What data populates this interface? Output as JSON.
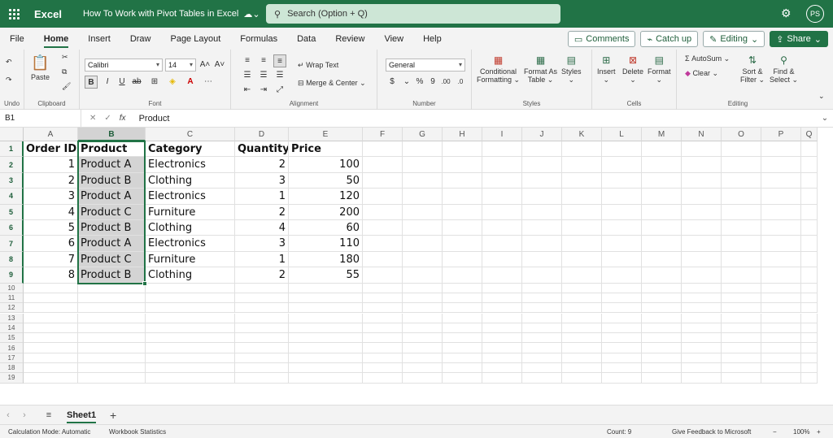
{
  "titlebar": {
    "app_name": "Excel",
    "doc_title": "How To Work with Pivot Tables in Excel",
    "search_placeholder": "Search (Option + Q)",
    "avatar_initials": "PS",
    "accent": "#217346"
  },
  "menu": {
    "tabs": [
      "File",
      "Home",
      "Insert",
      "Draw",
      "Page Layout",
      "Formulas",
      "Data",
      "Review",
      "View",
      "Help"
    ],
    "active_tab": "Home",
    "comments_label": "Comments",
    "catchup_label": "Catch up",
    "editing_label": "Editing",
    "share_label": "Share"
  },
  "ribbon": {
    "undo_label": "Undo",
    "clipboard": {
      "paste_label": "Paste",
      "group_label": "Clipboard"
    },
    "font": {
      "name": "Calibri",
      "size": "14",
      "group_label": "Font"
    },
    "alignment": {
      "wrap_label": "Wrap Text",
      "merge_label": "Merge & Center",
      "group_label": "Alignment"
    },
    "number": {
      "format": "General",
      "group_label": "Number"
    },
    "styles": {
      "conditional_label1": "Conditional",
      "conditional_label2": "Formatting",
      "format_as_label1": "Format As",
      "format_as_label2": "Table",
      "styles_label": "Styles",
      "group_label": "Styles"
    },
    "cells": {
      "insert_label": "Insert",
      "delete_label": "Delete",
      "format_label": "Format",
      "group_label": "Cells"
    },
    "editing": {
      "autosum_label": "AutoSum",
      "clear_label": "Clear",
      "sort_label1": "Sort &",
      "sort_label2": "Filter",
      "find_label1": "Find &",
      "find_label2": "Select",
      "group_label": "Editing"
    }
  },
  "formula_bar": {
    "name_box": "B1",
    "formula": "Product"
  },
  "grid": {
    "columns": [
      "A",
      "B",
      "C",
      "D",
      "E",
      "F",
      "G",
      "H",
      "I",
      "J",
      "K",
      "L",
      "M",
      "N",
      "O",
      "P",
      "Q"
    ],
    "selected_column": "B",
    "rows": [
      [
        "Order ID",
        "Product",
        "Category",
        "Quantity",
        "Price"
      ],
      [
        "1",
        "Product A",
        "Electronics",
        "2",
        "100"
      ],
      [
        "2",
        "Product B",
        "Clothing",
        "3",
        "50"
      ],
      [
        "3",
        "Product A",
        "Electronics",
        "1",
        "120"
      ],
      [
        "4",
        "Product C",
        "Furniture",
        "2",
        "200"
      ],
      [
        "5",
        "Product B",
        "Clothing",
        "4",
        "60"
      ],
      [
        "6",
        "Product A",
        "Electronics",
        "3",
        "110"
      ],
      [
        "7",
        "Product C",
        "Furniture",
        "1",
        "180"
      ],
      [
        "8",
        "Product B",
        "Clothing",
        "2",
        "55"
      ]
    ],
    "row_numbers": [
      "1",
      "2",
      "3",
      "4",
      "5",
      "6",
      "7",
      "8",
      "9",
      "10",
      "11",
      "12",
      "13",
      "14",
      "15",
      "16",
      "17",
      "18",
      "19"
    ]
  },
  "sheets": {
    "active": "Sheet1"
  },
  "status": {
    "calc_mode": "Calculation Mode: Automatic",
    "workbook_stats": "Workbook Statistics",
    "count": "Count: 9",
    "feedback": "Give Feedback to Microsoft",
    "zoom": "100%"
  }
}
